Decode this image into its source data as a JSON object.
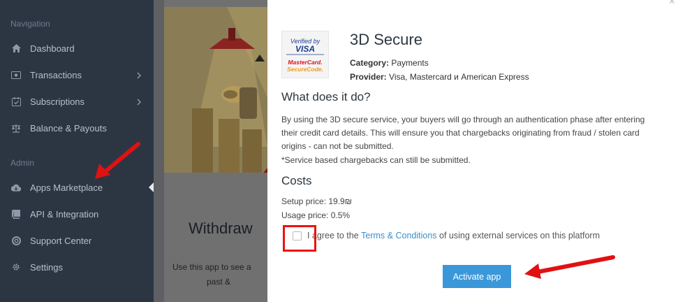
{
  "sidebar": {
    "navigation_heading": "Navigation",
    "admin_heading": "Admin",
    "nav_items": [
      {
        "label": "Dashboard",
        "icon": "dashboard-icon"
      },
      {
        "label": "Transactions",
        "icon": "transactions-icon"
      },
      {
        "label": "Subscriptions",
        "icon": "subscriptions-icon"
      },
      {
        "label": "Balance & Payouts",
        "icon": "balance-icon"
      }
    ],
    "admin_items": [
      {
        "label": "Apps Marketplace",
        "icon": "cloud-download-icon"
      },
      {
        "label": "API & Integration",
        "icon": "book-icon"
      },
      {
        "label": "Support Center",
        "icon": "lifebuoy-icon"
      },
      {
        "label": "Settings",
        "icon": "gear-icon"
      }
    ]
  },
  "background": {
    "card_title": "Withdraw",
    "card_desc_line1": "Use this app to see a",
    "card_desc_line2": "past &"
  },
  "modal": {
    "title": "3D Secure",
    "logo": {
      "line1": "Verified by",
      "line2": "VISA",
      "line3": "MasterCard.",
      "line4": "SecureCode."
    },
    "category_label": "Category:",
    "category_value": "Payments",
    "provider_label": "Provider:",
    "provider_value": "Visa, Mastercard и American Express",
    "what_heading": "What does it do?",
    "what_text": "By using the 3D secure service, your buyers will go through an authentication phase after entering their credit card details. This will ensure you that chargebacks originating from fraud / stolen card origins - can not be submitted.",
    "service_note": "*Service based chargebacks can still be submitted.",
    "costs_heading": "Costs",
    "setup_price": "Setup price: 19.9₪",
    "usage_price": "Usage price: 0.5%",
    "agree_prefix": "I agree to the",
    "terms_link": "Terms & Conditions",
    "agree_suffix": "of using external services on this platform",
    "activate_label": "Activate app",
    "close_label": "×"
  },
  "colors": {
    "sidebar_bg": "#2c3643",
    "accent_blue": "#3a97d9",
    "annotation_red": "#e11111"
  }
}
